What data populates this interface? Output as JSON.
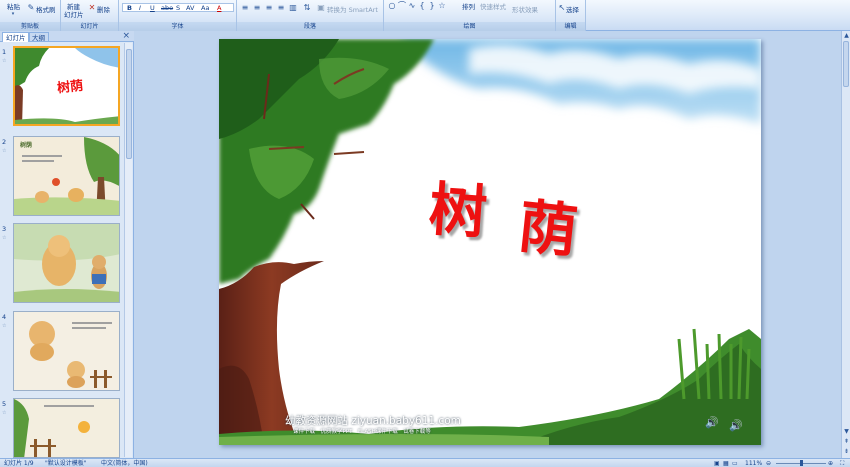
{
  "ribbon": {
    "clipboard": {
      "paste": "粘贴",
      "format_painter": "格式刷",
      "label": "剪贴板"
    },
    "slides": {
      "new_slide_line1": "新建",
      "new_slide_line2": "幻灯片",
      "delete": "删除",
      "label": "幻灯片"
    },
    "font": {
      "label": "字体",
      "bold": "B",
      "italic": "I",
      "underline": "U",
      "strike": "abe",
      "shadow": "S",
      "spacing": "AV",
      "case": "Aa",
      "color": "A"
    },
    "paragraph": {
      "label": "段落",
      "convert_smartart": "转换为 SmartArt"
    },
    "drawing": {
      "label": "绘图",
      "arrange": "排列",
      "quick_styles": "快速样式",
      "shape_effects": "形状效果"
    },
    "editing": {
      "label": "编辑",
      "select": "选择"
    }
  },
  "left_panel": {
    "tabs": [
      "幻灯片",
      "大纲"
    ],
    "close": "×",
    "thumbnails": [
      {
        "number": "1",
        "text": "树荫"
      },
      {
        "number": "2",
        "text": "树荫"
      },
      {
        "number": "3",
        "text": ""
      },
      {
        "number": "4",
        "text": ""
      },
      {
        "number": "5",
        "text": ""
      }
    ]
  },
  "slide": {
    "title_chars": [
      "树",
      "荫"
    ],
    "site": "幼教资源网站 ziyuan.baby611.com",
    "site_sub": "课件下载　优质教学PPT　FLASH课件下载　试卷下载等"
  },
  "status": {
    "slide_info": "幻灯片 1/9",
    "theme": "\"默认设计模板\"",
    "language": "中文(简体，中国)",
    "zoom": "111%"
  },
  "colors": {
    "title": "#ee1111",
    "accent": "#f5a623"
  }
}
